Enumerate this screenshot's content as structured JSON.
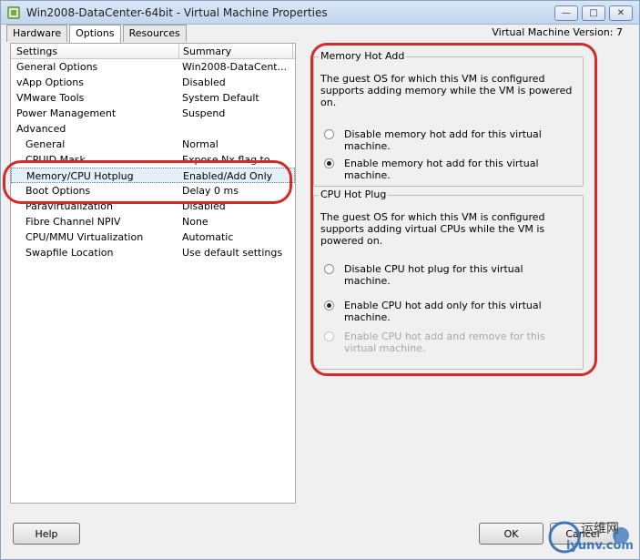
{
  "window": {
    "title": "Win2008-DataCenter-64bit - Virtual Machine Properties"
  },
  "tabs": [
    "Hardware",
    "Options",
    "Resources"
  ],
  "active_tab": "Options",
  "vm_version": "Virtual Machine Version: 7",
  "list": {
    "header": {
      "settings": "Settings",
      "summary": "Summary"
    },
    "rows": [
      {
        "setting": "General Options",
        "summary": "Win2008-DataCent..."
      },
      {
        "setting": "vApp Options",
        "summary": "Disabled"
      },
      {
        "setting": "VMware Tools",
        "summary": "System Default"
      },
      {
        "setting": "Power Management",
        "summary": "Suspend"
      },
      {
        "setting": "Advanced",
        "summary": ""
      },
      {
        "setting": "General",
        "summary": "Normal"
      },
      {
        "setting": "CPUID Mask",
        "summary": "Expose Nx flag to ..."
      },
      {
        "setting": "Memory/CPU Hotplug",
        "summary": "Enabled/Add Only"
      },
      {
        "setting": "Boot Options",
        "summary": "Delay 0 ms"
      },
      {
        "setting": "Paravirtualization",
        "summary": "Disabled"
      },
      {
        "setting": "Fibre Channel NPIV",
        "summary": "None"
      },
      {
        "setting": "CPU/MMU Virtualization",
        "summary": "Automatic"
      },
      {
        "setting": "Swapfile Location",
        "summary": "Use default settings"
      }
    ]
  },
  "memory_hot_add": {
    "title": "Memory Hot Add",
    "description": "The guest OS for which this VM is configured supports adding memory while the VM is powered on.",
    "options": [
      {
        "label": "Disable memory hot add for this virtual machine.",
        "selected": false
      },
      {
        "label": "Enable memory hot add for this virtual machine.",
        "selected": true
      }
    ]
  },
  "cpu_hot_plug": {
    "title": "CPU Hot Plug",
    "description": "The guest OS for which this VM is configured supports adding virtual CPUs while the VM is powered on.",
    "options": [
      {
        "label": "Disable CPU hot plug for this virtual machine.",
        "selected": false
      },
      {
        "label": "Enable CPU hot add only for this virtual machine.",
        "selected": true
      },
      {
        "label": "Enable CPU hot add and remove for this virtual machine.",
        "selected": false,
        "disabled": true
      }
    ]
  },
  "buttons": {
    "help": "Help",
    "ok": "OK",
    "cancel": "Cancel"
  },
  "watermark": {
    "text1": "运维网",
    "text2": "iyunv.com"
  },
  "colors": {
    "annotation": "#d42a2a",
    "selection": "#e5effa"
  }
}
